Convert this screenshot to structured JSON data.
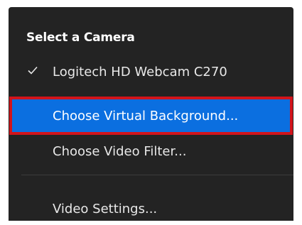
{
  "menu": {
    "section_title": "Select a Camera",
    "items": {
      "camera": {
        "label": "Logitech HD Webcam C270",
        "checked": true,
        "icon": "checkmark-icon"
      },
      "virtual_background": {
        "label": "Choose Virtual Background...",
        "highlighted": true
      },
      "video_filter": {
        "label": "Choose Video Filter..."
      },
      "video_settings": {
        "label": "Video Settings..."
      }
    }
  },
  "colors": {
    "menu_background": "#232323",
    "highlight": "#0b6fe0",
    "annotation_border": "#d1141b",
    "text": "#e8e8e8"
  }
}
